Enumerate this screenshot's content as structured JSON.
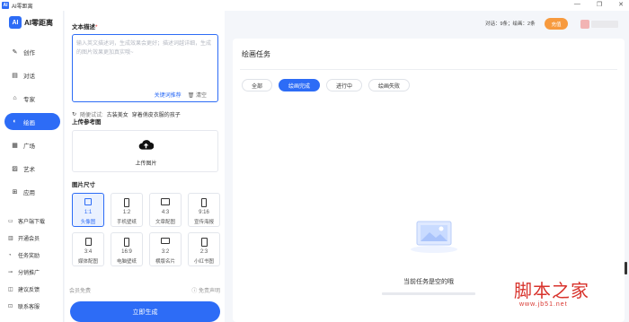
{
  "window": {
    "title": "AI零距离",
    "app_icon": "AI"
  },
  "brand": {
    "logo": "AI",
    "name": "AI零距离"
  },
  "nav": [
    {
      "label": "创作",
      "icon": "✎",
      "active": false
    },
    {
      "label": "对话",
      "icon": "▤",
      "active": false
    },
    {
      "label": "专家",
      "icon": "⌂",
      "active": false
    },
    {
      "label": "绘画",
      "icon": "◐",
      "active": true
    },
    {
      "label": "广场",
      "icon": "▦",
      "active": false
    },
    {
      "label": "艺术",
      "icon": "▨",
      "active": false
    },
    {
      "label": "应用",
      "icon": "⊞",
      "active": false
    }
  ],
  "nav_sub": [
    {
      "label": "客户端下载",
      "icon": "▭"
    },
    {
      "label": "开通会员",
      "icon": "▥"
    },
    {
      "label": "任务奖励",
      "icon": "◔"
    },
    {
      "label": "分销推广",
      "icon": "⊸"
    },
    {
      "label": "建议反馈",
      "icon": "◫"
    },
    {
      "label": "联系客服",
      "icon": "⊡"
    }
  ],
  "panel": {
    "prompt_label": "文本描述",
    "prompt_required": "*",
    "prompt_placeholder": "输入英文描述词，生成效果会更好；描述词越详细，生成的图片效果更加真实哦~",
    "keyword_recommend": "关键词推荐",
    "clear": "清空",
    "try_label": "随便试试:",
    "try_examples": [
      "古装美女",
      "穿着俏皮衣服的孩子"
    ],
    "upload_label": "上传参考图",
    "upload_text": "上传图片",
    "size_label": "图片尺寸",
    "sizes": [
      {
        "ratio": "1:1",
        "name": "头像图",
        "w": 8,
        "h": 8,
        "active": true
      },
      {
        "ratio": "1:2",
        "name": "手机壁纸",
        "w": 6,
        "h": 10,
        "active": false
      },
      {
        "ratio": "4:3",
        "name": "文章配图",
        "w": 10,
        "h": 8,
        "active": false
      },
      {
        "ratio": "9:16",
        "name": "宣传海报",
        "w": 6,
        "h": 10,
        "active": false
      },
      {
        "ratio": "3:4",
        "name": "媒体配图",
        "w": 7,
        "h": 9,
        "active": false
      },
      {
        "ratio": "16:9",
        "name": "电脑壁纸",
        "w": 6,
        "h": 10,
        "active": false
      },
      {
        "ratio": "3:2",
        "name": "横版名片",
        "w": 10,
        "h": 7,
        "active": false
      },
      {
        "ratio": "2:3",
        "name": "小红书图",
        "w": 7,
        "h": 10,
        "active": false
      }
    ],
    "member_free": "会员免费",
    "disclaimer": "免责声明",
    "generate": "立即生成"
  },
  "topbar": {
    "quota": "对话：9条；绘画：2条",
    "vip_button": "充值"
  },
  "tasks": {
    "title": "绘画任务",
    "tabs": [
      {
        "label": "全部",
        "active": false
      },
      {
        "label": "绘画完成",
        "active": true
      },
      {
        "label": "进行中",
        "active": false
      },
      {
        "label": "绘画失败",
        "active": false
      }
    ],
    "empty_text": "当前任务是空的哦"
  },
  "watermark": {
    "big": "脚本之家",
    "small": "www.jb51.net"
  },
  "colors": {
    "accent": "#2d6cf6",
    "vip": "#f79a3e",
    "watermark": "#d8332c"
  }
}
